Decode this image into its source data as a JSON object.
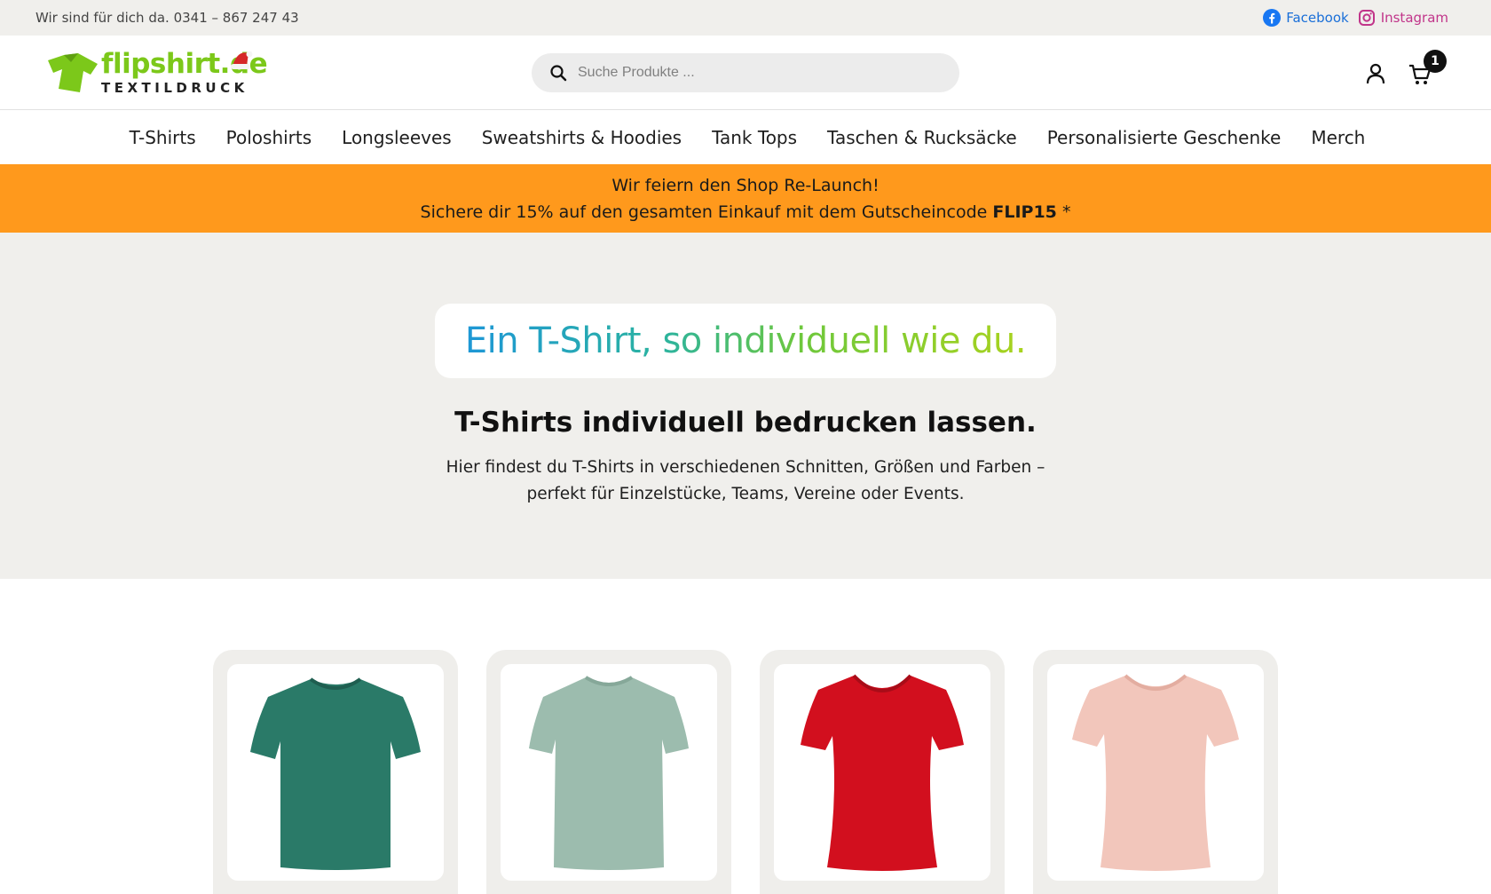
{
  "topbar": {
    "contact": "Wir sind für dich da. 0341 – 867 247 43",
    "facebook_label": "Facebook",
    "instagram_label": "Instagram"
  },
  "logo": {
    "brand": "flipshirt.de",
    "sub": "TEXTILDRUCK"
  },
  "search": {
    "placeholder": "Suche Produkte ..."
  },
  "cart": {
    "count": "1"
  },
  "nav": {
    "items": [
      "T-Shirts",
      "Poloshirts",
      "Longsleeves",
      "Sweatshirts & Hoodies",
      "Tank Tops",
      "Taschen & Rucksäcke",
      "Personalisierte Geschenke",
      "Merch"
    ]
  },
  "promo": {
    "line1": "Wir feiern den Shop Re-Launch!",
    "line2_prefix": "Sichere dir 15% auf den gesamten Einkauf mit dem Gutscheincode ",
    "code": "FLIP15",
    "line2_suffix": " *"
  },
  "hero": {
    "tagline": "Ein T-Shirt, so individuell wie du.",
    "title": "T-Shirts individuell bedrucken lassen.",
    "desc_line1": "Hier findest du T-Shirts in verschiedenen Schnitten, Größen und Farben –",
    "desc_line2": "perfekt für Einzelstücke, Teams, Vereine oder Events."
  },
  "colors": {
    "brand_green": "#7cc81a",
    "promo_orange": "#ff991c",
    "facebook_blue": "#1a6fd8",
    "instagram_pink": "#c1358a",
    "card_bg": "#efeeeb"
  },
  "products": [
    {
      "icon": "tshirt-teal-icon",
      "color": "#2a7a68"
    },
    {
      "icon": "tshirt-sage-icon",
      "color": "#9cbcae"
    },
    {
      "icon": "tshirt-red-icon",
      "color": "#d20f1e"
    },
    {
      "icon": "tshirt-rose-icon",
      "color": "#f2c6bb"
    }
  ]
}
